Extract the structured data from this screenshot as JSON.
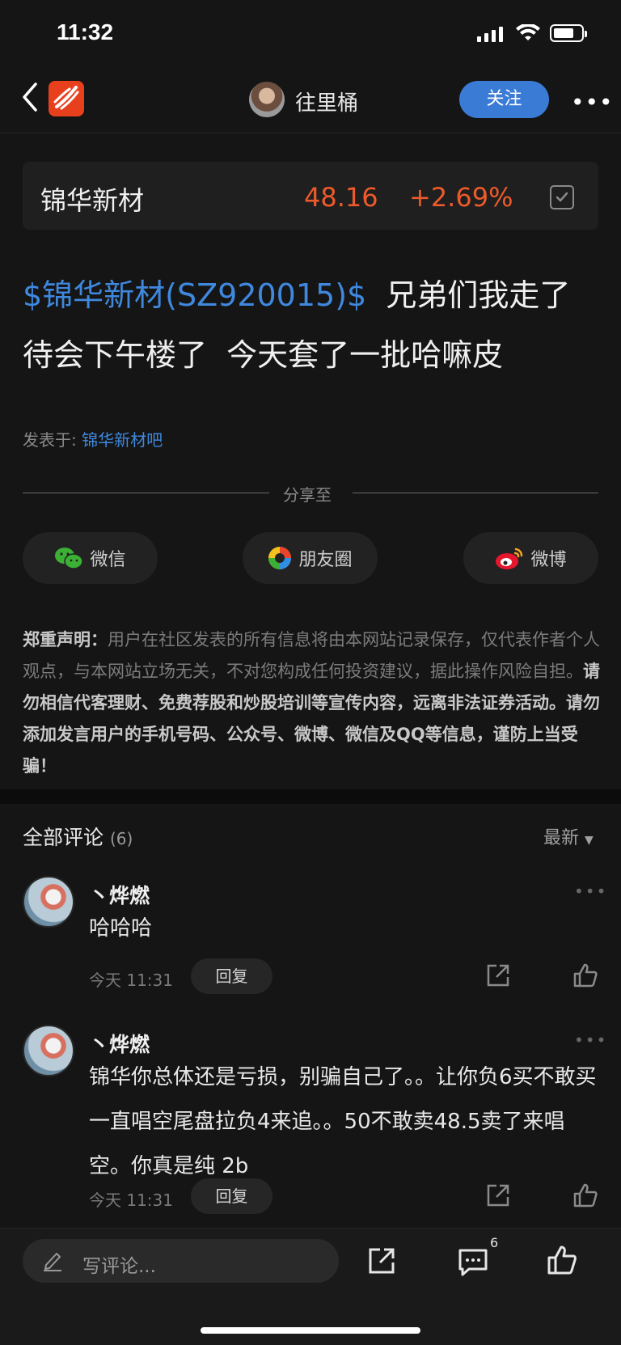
{
  "status_bar": {
    "time": "11:32"
  },
  "nav": {
    "username": "往里桶",
    "follow_label": "关注",
    "more_label": "•••"
  },
  "stock": {
    "name": "锦华新材",
    "price": "48.16",
    "change": "+2.69%"
  },
  "post": {
    "tag": "$锦华新材(SZ920015)$",
    "text_line1": "兄弟们我走了",
    "text_line2": "待会下午楼了  今天套了一批哈嘛皮",
    "posted_in_label": "发表于: ",
    "forum": "锦华新材吧"
  },
  "share": {
    "title": "分享至",
    "wechat": "微信",
    "moments": "朋友圈",
    "weibo": "微博"
  },
  "disclaimer": {
    "label": "郑重声明：",
    "text_normal": "用户在社区发表的所有信息将由本网站记录保存，仅代表作者个人观点，与本网站立场无关，不对您构成任何投资建议，据此操作风险自担。",
    "text_bold": "请勿相信代客理财、免费荐股和炒股培训等宣传内容，远离非法证券活动。请勿添加发言用户的手机号码、公众号、微博、微信及QQ等信息，谨防上当受骗！"
  },
  "comments": {
    "title": "全部评论",
    "count": "(6)",
    "sort_label": "最新",
    "items": [
      {
        "user": "丶烨燃",
        "text": "哈哈哈",
        "time": "今天 11:31",
        "reply_label": "回复"
      },
      {
        "user": "丶烨燃",
        "text": "锦华你总体还是亏损，别骗自己了。。让你负6买不敢买 一直唱空尾盘拉负4来追。。50不敢卖48.5卖了来唱空。你真是纯 2b",
        "time": "今天 11:31",
        "reply_label": "回复"
      }
    ]
  },
  "bottom_bar": {
    "placeholder": "写评论...",
    "comment_count": "6"
  },
  "colors": {
    "accent_blue": "#3a7bd5",
    "up_red": "#ee5a2a",
    "background": "#151515"
  }
}
